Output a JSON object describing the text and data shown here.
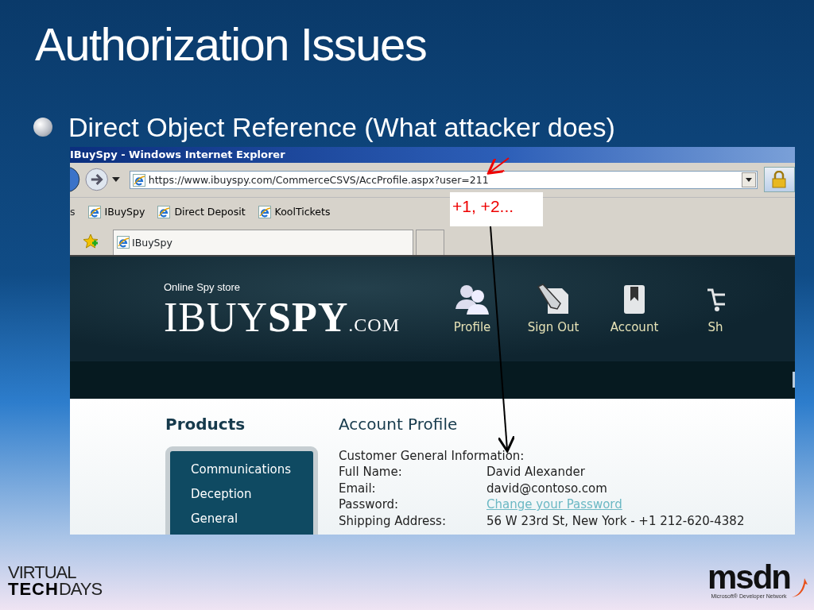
{
  "slide": {
    "title": "Authorization Issues",
    "bullets": [
      "Direct Object Reference (What attacker does)"
    ]
  },
  "browser": {
    "title": "IBuySpy - Windows Internet Explorer",
    "address": "https://www.ibuyspy.com/CommerceCSVS/AccProfile.aspx?user=211",
    "favorites_cut": "s",
    "favorites": [
      "IBuySpy",
      "Direct Deposit",
      "KoolTickets"
    ],
    "tabs": [
      {
        "label": "IBuySpy",
        "selected": true
      }
    ]
  },
  "site": {
    "tagline": "Online Spy store",
    "logo": "IBUY**SPY**",
    "logo_suffix": ".COM",
    "nav": [
      {
        "label": "Profile",
        "kind": "people"
      },
      {
        "label": "Sign Out",
        "kind": "pencil"
      },
      {
        "label": "Account",
        "kind": "bookmark"
      },
      {
        "label": "Sh",
        "kind": "cart"
      }
    ],
    "sidebar_heading": "Products",
    "categories": [
      "Communications",
      "Deception",
      "General"
    ],
    "page_heading": "Account Profile",
    "section_label": "Customer General Information:",
    "fields": [
      {
        "label": "Full Name:",
        "value": "David Alexander",
        "kind": "text"
      },
      {
        "label": "Email:",
        "value": "david@contoso.com",
        "kind": "text"
      },
      {
        "label": "Password:",
        "value": "Change your Password",
        "kind": "link"
      },
      {
        "label": "Shipping Address:",
        "value": "56 W 23rd St, New York - +1 212-620-4382",
        "kind": "text"
      }
    ]
  },
  "annotation": {
    "text": "+1, +2..."
  },
  "footer": {
    "left_logo_top": "VIRTUAL",
    "left_logo_bottom": "**TECH**DAYS",
    "right_logo": "msdn",
    "right_logo_caption": "Microsoft® Developer Network"
  }
}
